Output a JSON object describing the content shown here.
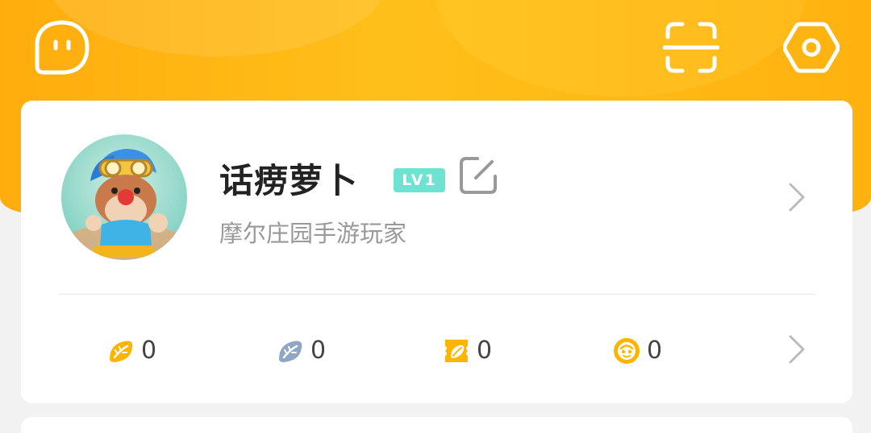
{
  "header": {
    "icons": {
      "left": "chat-bubble-icon",
      "scan": "scan-icon",
      "settings": "hexagon-settings-icon"
    },
    "colors": {
      "accent": "#ffb20f",
      "card": "#ffffff",
      "level_badge": "#6fe3d2"
    }
  },
  "profile": {
    "nickname": "话痨萝卜",
    "level": "LV1",
    "subtitle": "摩尔庄园手游玩家",
    "avatar_icon": "mole-character-avatar",
    "edit_icon": "edit-icon"
  },
  "stats": [
    {
      "icon": "gold-bean-icon",
      "value": "0"
    },
    {
      "icon": "silver-bean-icon",
      "value": "0"
    },
    {
      "icon": "coupon-icon",
      "value": "0"
    },
    {
      "icon": "coin-icon",
      "value": "0"
    }
  ]
}
